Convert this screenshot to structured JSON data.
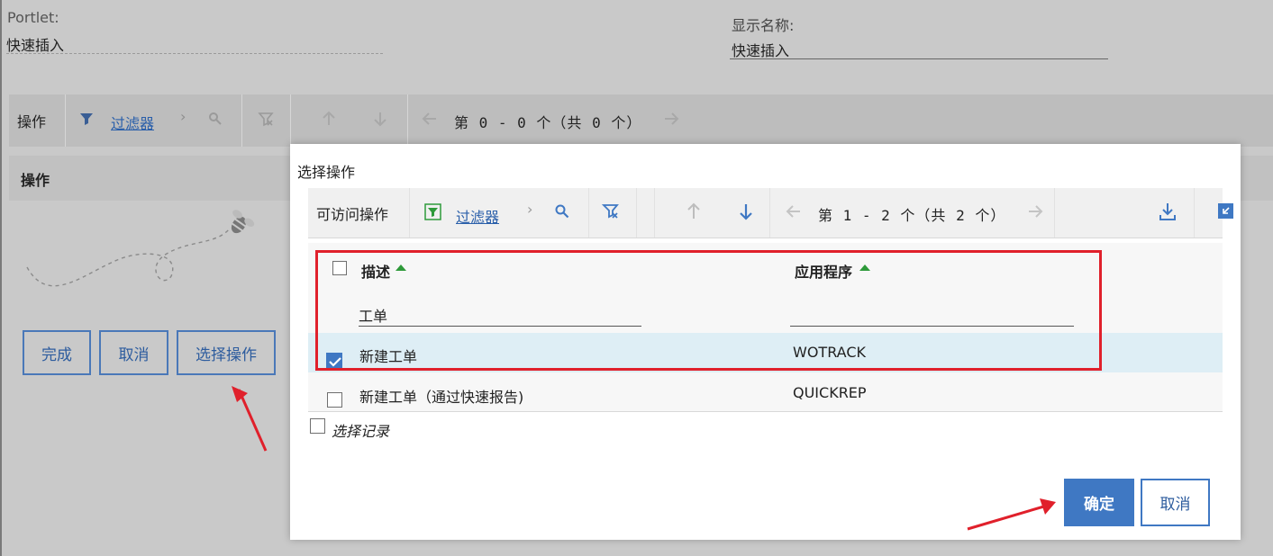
{
  "background": {
    "portlet_label": "Portlet:",
    "portlet_value": "快速插入",
    "display_name_label": "显示名称:",
    "display_name_value": "快速插入",
    "toolbar": {
      "title": "操作",
      "filter_label": "过滤器",
      "pager_text": "第 0 - 0 个（共 0 个）"
    },
    "section_header": "操作",
    "buttons": {
      "done": "完成",
      "cancel": "取消",
      "select_action": "选择操作"
    }
  },
  "dialog": {
    "title": "选择操作",
    "toolbar": {
      "title": "可访问操作",
      "filter_label": "过滤器",
      "pager_text": "第 1 - 2 个（共 2 个）"
    },
    "table": {
      "columns": [
        "描述",
        "应用程序"
      ],
      "filter_values": {
        "description": "工单",
        "application": ""
      },
      "rows": [
        {
          "checked": true,
          "description": "新建工单",
          "application": "WOTRACK"
        },
        {
          "checked": false,
          "description": "新建工单（通过快速报告)",
          "application": "QUICKREP"
        }
      ]
    },
    "select_records_label": "选择记录",
    "ok_button": "确定",
    "cancel_button": "取消"
  },
  "colors": {
    "accent": "#3f78c3",
    "highlight_box": "#e0202b",
    "selected_row": "#deeef5",
    "sort_arrow": "#2e9a3a"
  }
}
